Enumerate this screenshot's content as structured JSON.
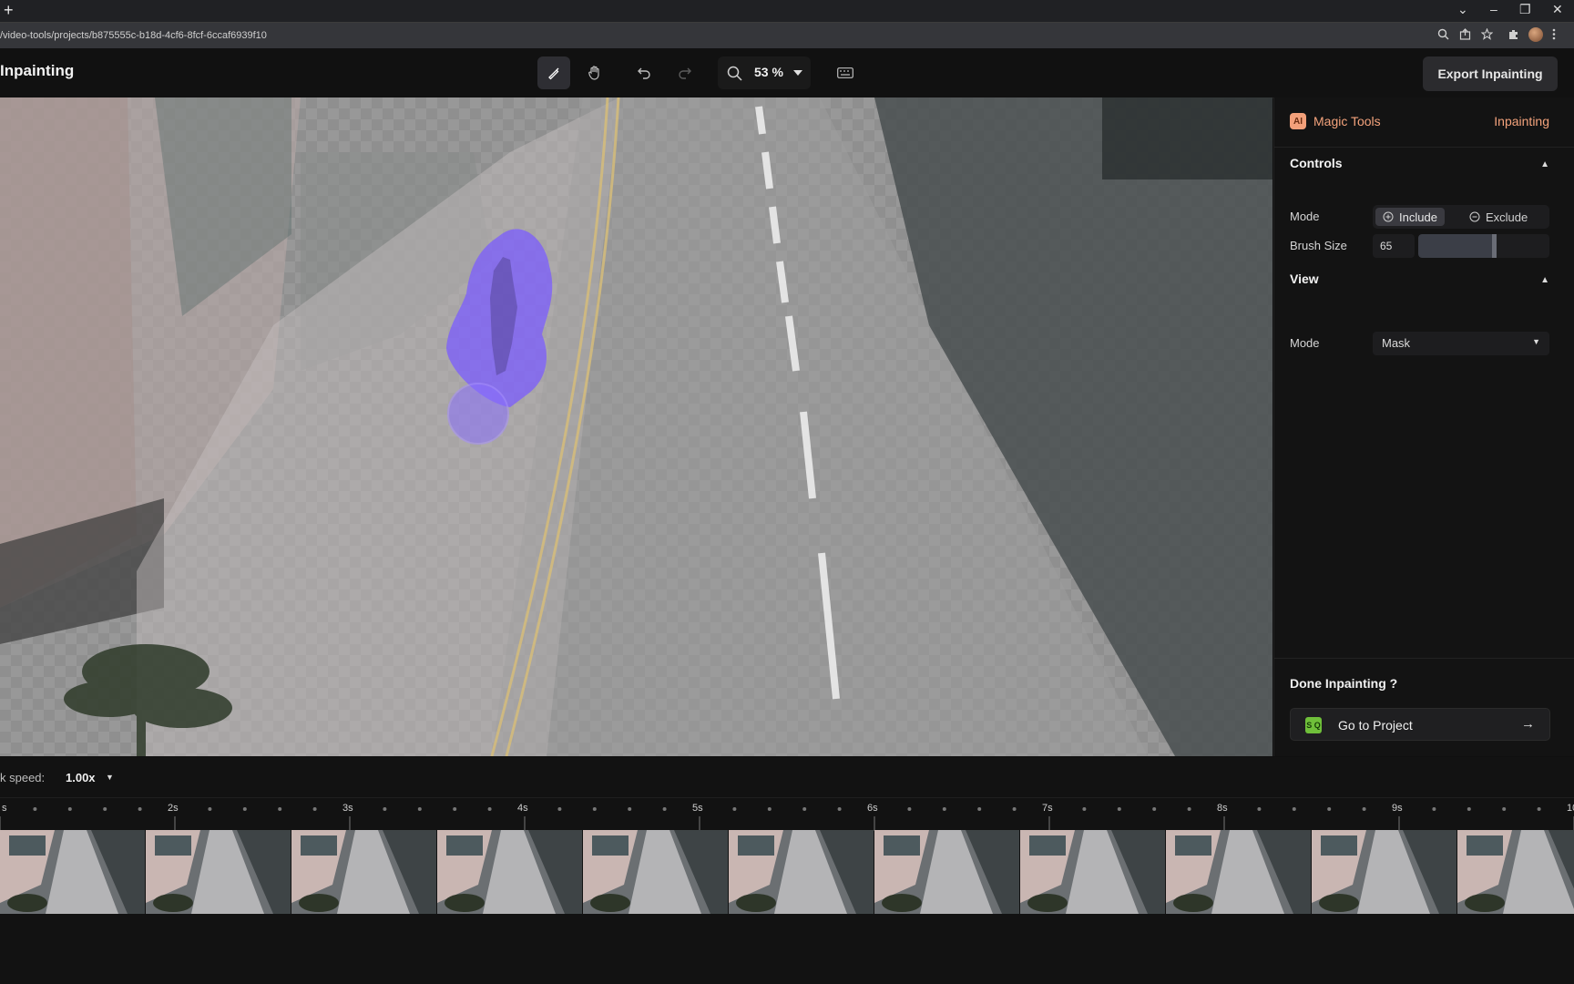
{
  "browser": {
    "new_tab_symbol": "+",
    "url": "/video-tools/projects/b875555c-b18d-4cf6-8fcf-6ccaf6939f10",
    "window_controls": [
      "⌄",
      "–",
      "❐",
      "✕"
    ]
  },
  "header": {
    "title": "Inpainting",
    "zoom": "53 %",
    "export_label": "Export Inpainting"
  },
  "panel": {
    "brand": "Magic Tools",
    "ai_badge": "AI",
    "active_tool": "Inpainting",
    "controls": {
      "title": "Controls",
      "mode_label": "Mode",
      "mode_include": "Include",
      "mode_exclude": "Exclude",
      "brush_label": "Brush Size",
      "brush_value": "65",
      "brush_fraction": 0.6
    },
    "view": {
      "title": "View",
      "mode_label": "Mode",
      "mode_value": "Mask"
    },
    "done_title": "Done Inpainting ?",
    "go_label": "Go to Project",
    "go_icon_text": "S Q"
  },
  "timeline": {
    "speed_label": "k speed:",
    "speed_value": "1.00x",
    "time_labels": [
      "s",
      "2s",
      "3s",
      "4s",
      "5s",
      "6s",
      "7s",
      "8s",
      "9s",
      "10"
    ]
  },
  "colors": {
    "accent": "#f4a37c",
    "mask": "#7b5cff"
  }
}
